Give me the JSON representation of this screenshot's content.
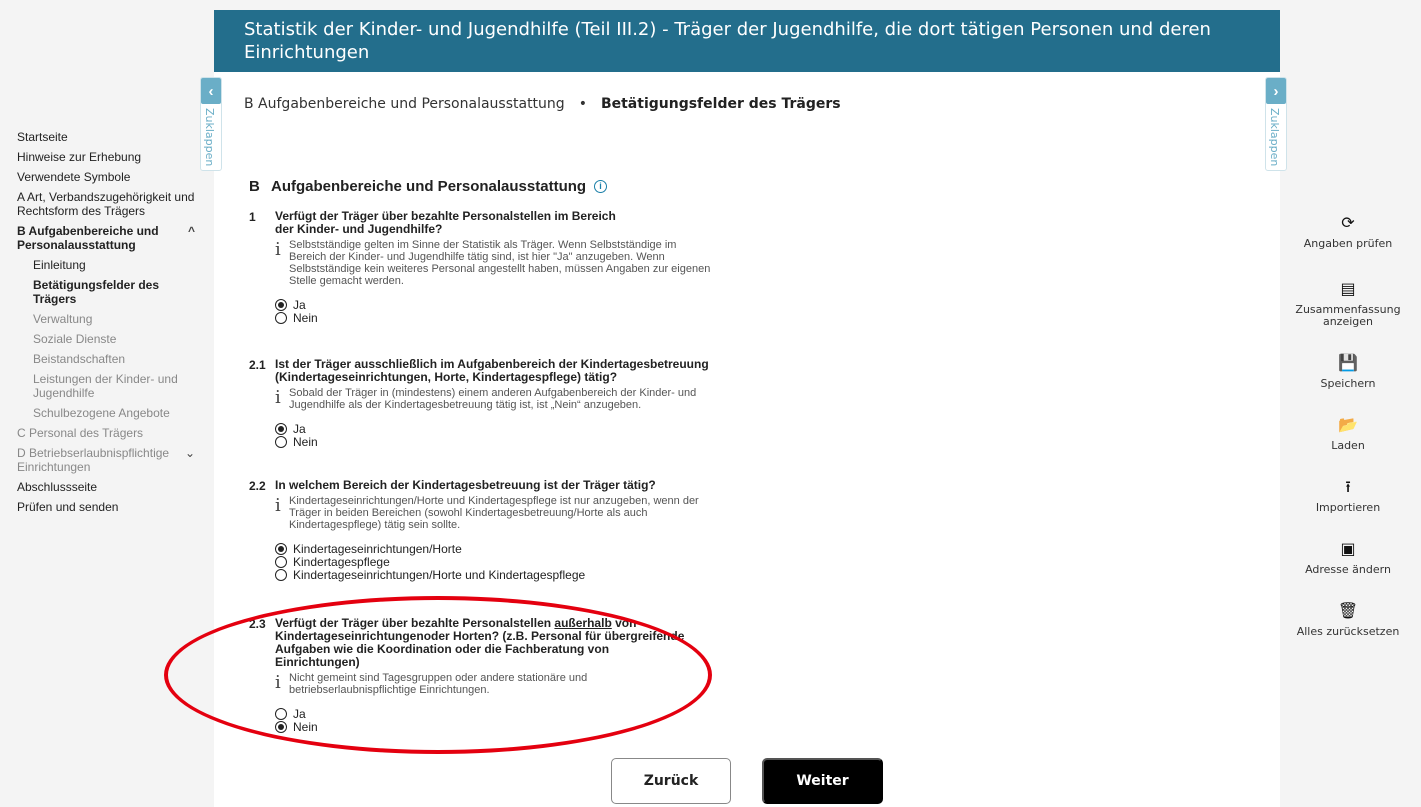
{
  "header": {
    "title": "Statistik der Kinder- und Jugendhilfe (Teil III.2) - Träger der Jugendhilfe, die dort tätigen Personen und deren Einrichtungen"
  },
  "collapse": {
    "left_label": "Zuklappen",
    "right_label": "Zuklappen",
    "left_arrow": "‹",
    "right_arrow": "›"
  },
  "breadcrumb": {
    "parent": "B Aufgabenbereiche und Personalausstattung",
    "separator": "•",
    "current": "Betätigungsfelder des Trägers"
  },
  "nav": {
    "items": [
      {
        "label": "Startseite"
      },
      {
        "label": "Hinweise zur Erhebung"
      },
      {
        "label": "Verwendete Symbole"
      },
      {
        "label": "A Art, Verbandszugehörigkeit und Rechtsform des Trägers"
      },
      {
        "label": "B Aufgabenbereiche und Personalausstattung",
        "chevron": "^"
      },
      {
        "label": "Einleitung"
      },
      {
        "label": "Betätigungsfelder des Trägers"
      },
      {
        "label": "Verwaltung"
      },
      {
        "label": "Soziale Dienste"
      },
      {
        "label": "Beistandschaften"
      },
      {
        "label": "Leistungen der Kinder- und Jugendhilfe"
      },
      {
        "label": "Schulbezogene Angebote"
      },
      {
        "label": "C Personal des Trägers"
      },
      {
        "label": "D Betriebserlaubnispflichtige Einrichtungen",
        "chevron": "⌄"
      },
      {
        "label": "Abschlussseite"
      },
      {
        "label": "Prüfen und senden"
      }
    ]
  },
  "section": {
    "letter": "B",
    "title": "Aufgabenbereiche und Personalausstattung",
    "info_icon": "i"
  },
  "questions": {
    "q1": {
      "num": "1",
      "text": "Verfügt der Träger über bezahlte Personalstellen im Bereich der Kinder- und Jugendhilfe?",
      "hint": "Selbstständige gelten im Sinne der Statistik als Träger. Wenn Selbstständige im Bereich der Kinder- und Jugendhilfe tätig sind, ist hier \"Ja\" anzugeben. Wenn Selbstständige kein weiteres Personal angestellt haben, müssen Angaben zur eigenen Stelle gemacht werden.",
      "options": [
        "Ja",
        "Nein"
      ],
      "selected": "Ja"
    },
    "q21": {
      "num": "2.1",
      "text": "Ist der Träger ausschließlich im Aufgabenbereich der Kindertagesbetreuung (Kindertageseinrichtungen, Horte, Kindertagespflege) tätig?",
      "hint": "Sobald der Träger in (mindestens) einem anderen Aufgabenbereich der Kinder- und Jugendhilfe als der Kindertagesbetreuung tätig ist, ist „Nein“ anzugeben.",
      "options": [
        "Ja",
        "Nein"
      ],
      "selected": "Ja"
    },
    "q22": {
      "num": "2.2",
      "text": "In welchem Bereich der Kindertagesbetreuung ist der Träger tätig?",
      "hint": "Kindertageseinrichtungen/Horte und Kindertagespflege ist nur anzugeben, wenn der Träger in beiden Bereichen (sowohl Kindertagesbetreuung/Horte als auch Kindertagespflege) tätig sein sollte.",
      "options": [
        "Kindertageseinrichtungen/Horte",
        "Kindertagespflege",
        "Kindertageseinrichtungen/Horte und Kindertagespflege"
      ],
      "selected": "Kindertageseinrichtungen/Horte"
    },
    "q23": {
      "num": "2.3",
      "text_before": "Verfügt der Träger über bezahlte Personalstellen ",
      "text_underlined": "außerhalb",
      "text_after": " von Kindertageseinrichtungenoder Horten? (z.B. Personal für übergreifende Aufgaben wie die Koordination oder die Fachberatung von Einrichtungen)",
      "hint": "Nicht gemeint sind Tagesgruppen oder andere stationäre und betriebserlaubnispflichtige Einrichtungen.",
      "options": [
        "Ja",
        "Nein"
      ],
      "selected": "Nein"
    }
  },
  "hint_icon": "i",
  "buttons": {
    "back": "Zurück",
    "next": "Weiter"
  },
  "tools": [
    {
      "label": "Angaben prüfen",
      "icon": "check-cycle-icon",
      "glyph": "⟳"
    },
    {
      "label": "Zusammenfassung anzeigen",
      "icon": "summary-icon",
      "glyph": "▤"
    },
    {
      "label": "Speichern",
      "icon": "save-icon",
      "glyph": "💾"
    },
    {
      "label": "Laden",
      "icon": "folder-icon",
      "glyph": "📂"
    },
    {
      "label": "Importieren",
      "icon": "upload-icon",
      "glyph": "⭱"
    },
    {
      "label": "Adresse ändern",
      "icon": "address-card-icon",
      "glyph": "▣"
    },
    {
      "label": "Alles zurücksetzen",
      "icon": "trash-icon",
      "glyph": "🗑"
    }
  ],
  "colors": {
    "header": "#236e8c",
    "accent": "#6aaec7",
    "highlight": "#e4000f"
  }
}
